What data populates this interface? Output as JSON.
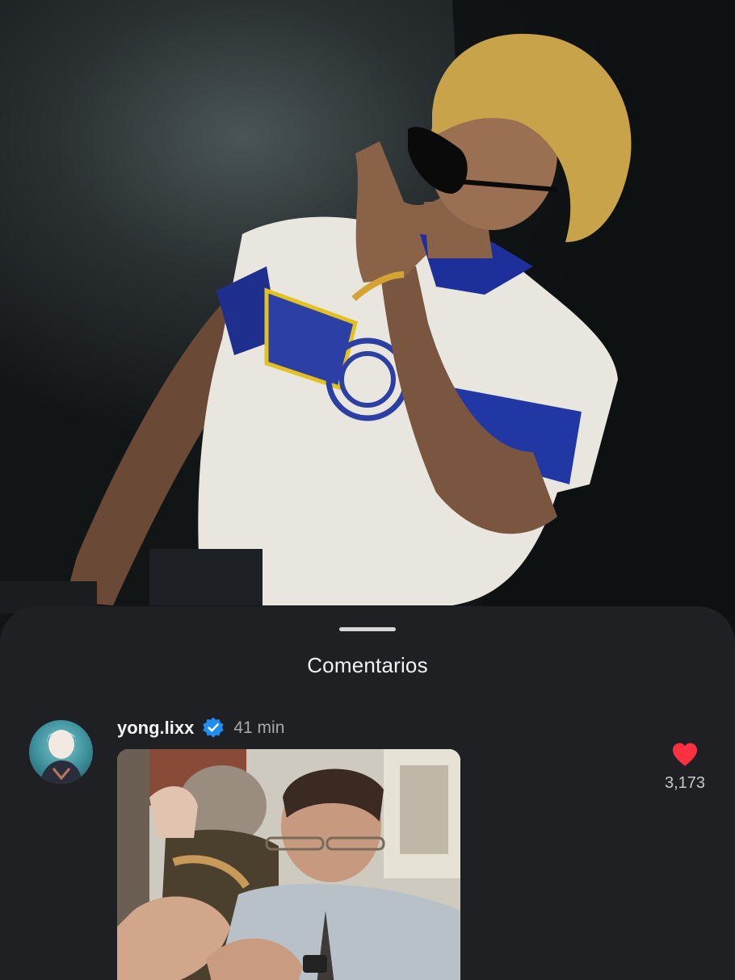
{
  "sheet": {
    "title": "Comentarios"
  },
  "comment": {
    "username": "yong.lixx",
    "verified": true,
    "time": "41 min",
    "like_count": "3,173",
    "liked": true,
    "icons": {
      "verified": "verified-badge-icon",
      "like": "heart-icon"
    }
  },
  "colors": {
    "sheet_background": "#1f2023",
    "verified_blue": "#1f8ef1",
    "heart_red": "#ff3040",
    "muted_text": "#a8a9ad"
  }
}
